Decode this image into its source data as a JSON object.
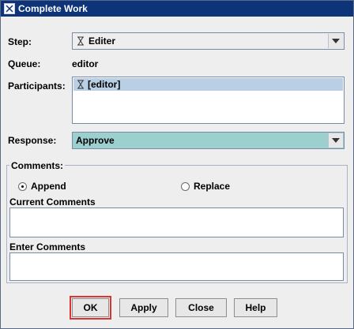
{
  "window": {
    "title": "Complete Work"
  },
  "form": {
    "step_label": "Step:",
    "step_value": "Editer",
    "queue_label": "Queue:",
    "queue_value": "editor",
    "participants_label": "Participants:",
    "participants": [
      "[editor]"
    ],
    "response_label": "Response:",
    "response_value": "Approve",
    "response_bg": "#9bd0cf"
  },
  "comments": {
    "group_label": "Comments:",
    "append_label": "Append",
    "replace_label": "Replace",
    "selected": "Append",
    "current_label": "Current Comments",
    "current_value": "",
    "enter_label": "Enter Comments",
    "enter_value": ""
  },
  "buttons": {
    "ok": "OK",
    "apply": "Apply",
    "close": "Close",
    "help": "Help"
  },
  "colors": {
    "title_bar": "#0d3478",
    "focus_highlight": "#dd3333"
  },
  "icons": {
    "step": "hourglass-icon",
    "participant": "hourglass-icon",
    "dropdown": "chevron-down-icon"
  }
}
